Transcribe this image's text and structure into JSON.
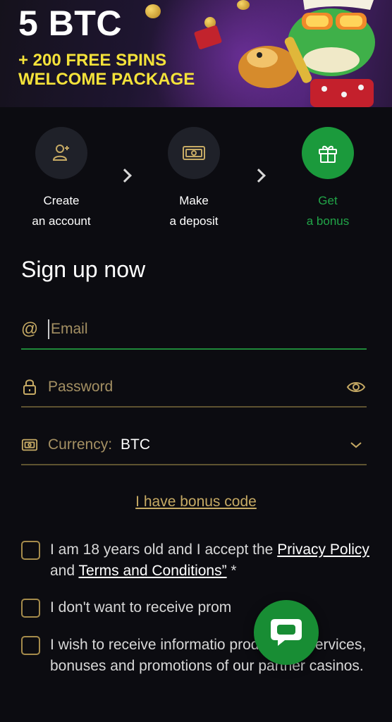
{
  "banner": {
    "amount": "5 BTC",
    "promo_line1": "+ 200 FREE SPINS",
    "promo_line2": "WELCOME PACKAGE"
  },
  "steps": [
    {
      "line1": "Create",
      "line2": "an account",
      "icon": "user-add-icon",
      "active": false
    },
    {
      "line1": "Make",
      "line2": "a deposit",
      "icon": "banknote-icon",
      "active": false
    },
    {
      "line1": "Get",
      "line2": "a bonus",
      "icon": "gift-icon",
      "active": true
    }
  ],
  "form": {
    "title": "Sign up now",
    "email_placeholder": "Email",
    "password_placeholder": "Password",
    "currency_label": "Currency:",
    "currency_value": "BTC",
    "bonus_link": "I have bonus code"
  },
  "checkboxes": {
    "age": {
      "prefix": "I am 18 years old and I accept the ",
      "link1": "Privacy Policy",
      "mid": " and ",
      "link2": "Terms and Conditions”",
      "suffix": " *"
    },
    "promo": "I don't want to receive prom",
    "partners": "I wish to receive informatio products or services, bonuses and promotions of our partner casinos."
  },
  "colors": {
    "accent_green": "#1b9a3c",
    "gold": "#c6aa64",
    "promo_yellow": "#f4e23a",
    "background": "#0c0c11"
  }
}
